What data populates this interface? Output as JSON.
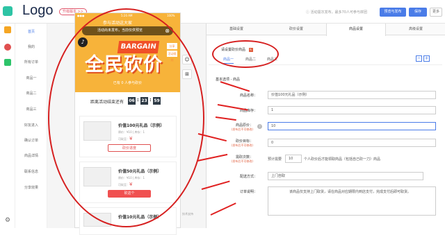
{
  "header": {
    "logo": "Logo",
    "version_badge": "升级版本 >>",
    "hint": "活动需次发布，最多70人可参与拼团",
    "preview_publish": "预览与发布",
    "save": "保存",
    "more": "更多"
  },
  "sidebar": {
    "items": [
      {
        "label": "首页"
      },
      {
        "label": "我的"
      },
      {
        "label": "所有订单"
      },
      {
        "label": "商品一"
      },
      {
        "label": "商品二"
      },
      {
        "label": "商品三"
      },
      {
        "label": "好友进入"
      },
      {
        "label": "确认订单"
      },
      {
        "label": "商品详情"
      },
      {
        "label": "联系信息"
      },
      {
        "label": "分享效果"
      }
    ]
  },
  "phone": {
    "status_time": "5:20 AM",
    "status_title": "参与活动这大家",
    "status_battery": "100%",
    "bubble": "活动尚未发布，当前仅供预览",
    "share_tag": "分享",
    "rule_tag": "活动规则",
    "bargain_en": "BARGAIN",
    "bargain_cn": "全民砍价",
    "participants": "已有 0 人参与砍价",
    "countdown_label": "距离活动结束还有",
    "countdown": {
      "days": "06",
      "hours": "23",
      "minutes": "59"
    },
    "products": [
      {
        "title": "价值100元礼品（示例）",
        "price": "原价：¥10 | 库存：1",
        "min": "可砍至：",
        "min_value": "¥",
        "button": "砍价进度"
      },
      {
        "title": "价值50元礼品（示例）",
        "price": "原价：¥10 | 库存：1",
        "min": "可砍至：",
        "min_value": "¥",
        "button": "砍这个"
      },
      {
        "title": "价值10元礼品（示例）",
        "price": "",
        "min": "",
        "min_value": "",
        "button": ""
      }
    ],
    "footer_note": "技术支持"
  },
  "panel": {
    "tabs": [
      {
        "label": "基础设置"
      },
      {
        "label": "砍价设置"
      },
      {
        "label": "商品设置"
      },
      {
        "label": "高级设置"
      }
    ],
    "product_select_label": "请设置砍价商品",
    "sub_tabs": [
      {
        "label": "商品一"
      },
      {
        "label": "商品二"
      },
      {
        "label": "商品三"
      }
    ],
    "section_title": "基本选项 - 商品",
    "fields": {
      "name": {
        "label": "商品名称：",
        "value": "价值100元礼品（示例）"
      },
      "stock": {
        "label": "商品库存：",
        "value": "1"
      },
      "price": {
        "label": "商品原价：",
        "sub": "(发布后不可修改)",
        "value": "10"
      },
      "target": {
        "label": "砍价目标：",
        "sub": "(发布后不可修改)",
        "value": "0"
      },
      "times": {
        "label": "需砍次数：",
        "sub": "(发布后不可修改)",
        "prefix": "预计需要",
        "value": "10",
        "suffix": "个人砍价后才能领取商品（包括自己砍一刀）商品"
      },
      "delivery": {
        "label": "配送方式：",
        "value": "上门自取"
      },
      "note": {
        "label": "订单说明：",
        "value": "该商品仅支持上门取货，请在商品对应期限内到店支付，完成支付后即可取货。"
      }
    }
  }
}
